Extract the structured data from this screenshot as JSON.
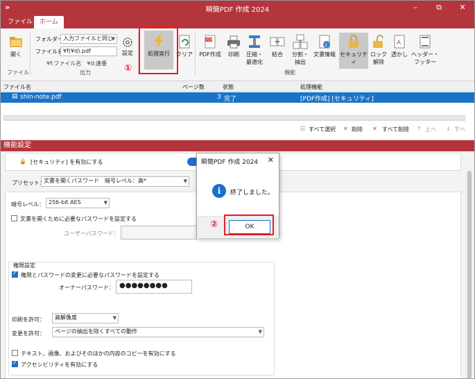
{
  "titlebar": {
    "title": "瞬簡PDF 作成 2024",
    "quick_access": "»",
    "minimize": "–",
    "restore": "▫",
    "close": "✕",
    "restore_alt": "⧉"
  },
  "tabs": [
    {
      "label": "ファイル"
    },
    {
      "label": "ホーム"
    }
  ],
  "ribbon": {
    "open_label": "開く",
    "file_group_label": "ファイル",
    "folder_label": "フォルダー",
    "folder_value": "入力ファイルと同じ",
    "filename_label": "ファイル名",
    "filename_value": "¥f(¥d).pdf",
    "hint": "¥f:ファイル名　¥d:連番",
    "output_group_label": "出力",
    "settings_label": "設定",
    "process_label": "処理実行",
    "clear_label": "クリア",
    "pdf_create_label": "PDF作成",
    "print_label": "印刷",
    "compress_label_1": "圧縮・",
    "compress_label_2": "最適化",
    "merge_label": "結合",
    "split_label_1": "分割・",
    "split_label_2": "抽出",
    "docinfo_label": "文書情報",
    "security_label": "セキュリティ",
    "lock_label_1": "ロック",
    "lock_label_2": "解除",
    "watermark_label": "透かし",
    "headerfooter_label_1": "ヘッダー・",
    "headerfooter_label_2": "フッター",
    "function_group_label": "機能",
    "step1": "①"
  },
  "filelist": {
    "col_name": "ファイル名",
    "col_pages": "ページ数",
    "col_status": "状態",
    "col_function": "処理機能",
    "rows": [
      {
        "name": "shin-note.pdf",
        "pages": "3",
        "status": "完了",
        "function": "[PDF作成] [セキュリティ]"
      }
    ],
    "select_all": "すべて選択",
    "delete": "削除",
    "delete_all": "すべて削除",
    "up": "上へ",
    "down": "下へ"
  },
  "settings": {
    "section_title": "機能設定",
    "enable_security": "[セキュリティ] を有効にする",
    "preset_label": "プリセット：",
    "preset_value": "文書を開くパスワード　暗号レベル：高*",
    "encryption_label": "暗号レベル：",
    "encryption_value": "256-bit AES",
    "open_password_checkbox": "文書を開くために必要なパスワードを設定する",
    "user_password_label": "ユーザーパスワード：",
    "permissions_title": "権限設定",
    "permissions_checkbox": "権限とパスワードの変更に必要なパスワードを設定する",
    "owner_password_label": "オーナーパスワード：",
    "owner_password_value": "●●●●●●●●",
    "print_allow_label": "印刷を許可：",
    "print_allow_value": "高解像度",
    "change_allow_label": "変更を許可：",
    "change_allow_value": "ページの抽出を除くすべての動作",
    "copy_checkbox": "テキスト、画像、およびそのほかの内容のコピーを有効にする",
    "accessibility_checkbox": "アクセシビリティを有効にする"
  },
  "dialog": {
    "title": "瞬簡PDF 作成 2024",
    "close": "✕",
    "icon_glyph": "i",
    "message": "終了しました。",
    "ok_label": "OK",
    "step2": "②"
  },
  "colors": {
    "accent": "#b5353d",
    "selection": "#1a73c8",
    "highlight": "#e0202a"
  }
}
